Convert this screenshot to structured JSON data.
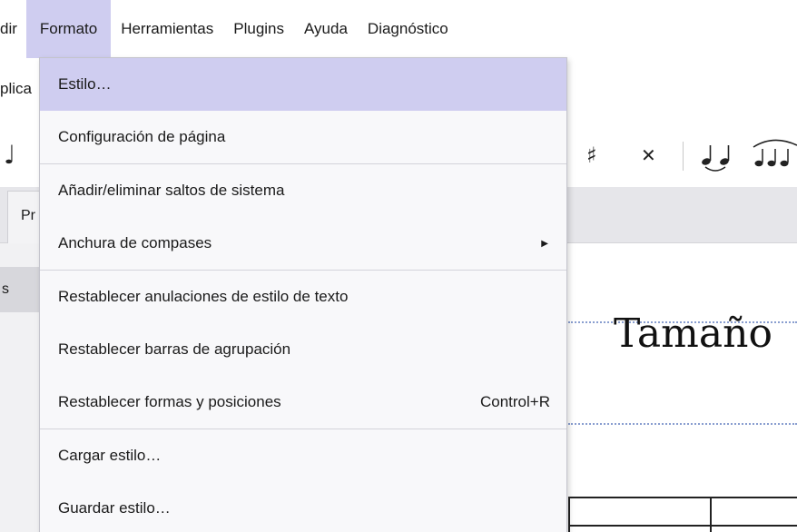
{
  "menubar": {
    "items": [
      {
        "label": "dir"
      },
      {
        "label": "Formato",
        "active": true
      },
      {
        "label": "Herramientas"
      },
      {
        "label": "Plugins"
      },
      {
        "label": "Ayuda"
      },
      {
        "label": "Diagnóstico"
      }
    ]
  },
  "row2": {
    "label": "plica"
  },
  "tabbar": {
    "tab_label": "Pr"
  },
  "leftpanel": {
    "item_label": "s"
  },
  "score": {
    "title": "Tamaño"
  },
  "toolbar": {
    "icons": [
      "sharp-icon",
      "double-sharp-icon",
      "tie-icon",
      "slur-icon"
    ]
  },
  "format_menu": {
    "items": [
      {
        "label": "Estilo…",
        "highlighted": true
      },
      {
        "label": "Configuración de página"
      },
      {
        "label": "Añadir/eliminar saltos de sistema"
      },
      {
        "label": "Anchura de compases",
        "submenu": true
      },
      {
        "label": "Restablecer anulaciones de estilo de texto"
      },
      {
        "label": "Restablecer barras de agrupación"
      },
      {
        "label": "Restablecer formas y posiciones",
        "shortcut": "Control+R"
      },
      {
        "label": "Cargar estilo…"
      },
      {
        "label": "Guardar estilo…"
      }
    ]
  },
  "colors": {
    "highlight": "#cfcdf0",
    "menu_background": "#f8f8fa",
    "dotted_line": "#8a9fd0"
  }
}
